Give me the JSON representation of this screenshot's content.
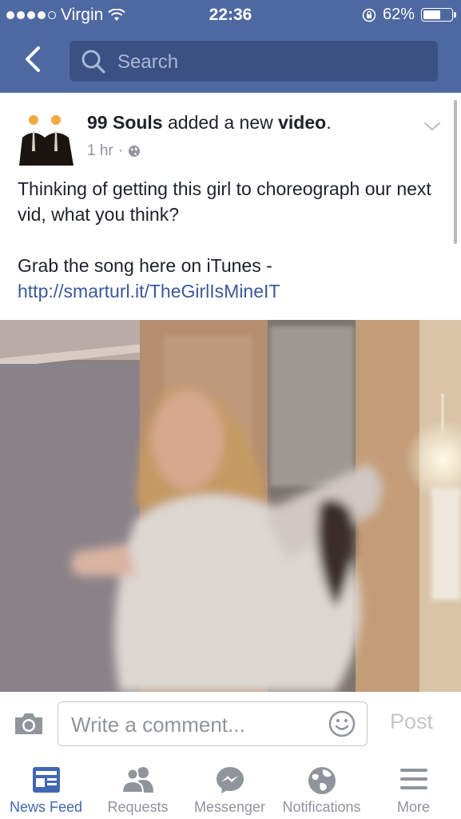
{
  "status": {
    "carrier": "Virgin",
    "time": "22:36",
    "battery_text": "62%",
    "battery_level": 0.62
  },
  "nav": {
    "search_placeholder": "Search"
  },
  "post": {
    "page_name": "99 Souls",
    "action": "added a new",
    "object": "video",
    "punct": ".",
    "time": "1 hr",
    "separator": "·",
    "text_line": "Thinking of getting this girl to choreograph our next vid, what you think?",
    "link_intro": "Grab the song here on iTunes - ",
    "link_url": "http://smarturl.it/TheGirlIsMineIT"
  },
  "comment": {
    "placeholder": "Write a comment...",
    "post_label": "Post"
  },
  "tabs": [
    {
      "label": "News Feed",
      "icon": "news-feed-icon",
      "active": true
    },
    {
      "label": "Requests",
      "icon": "friend-requests-icon",
      "active": false
    },
    {
      "label": "Messenger",
      "icon": "messenger-icon",
      "active": false
    },
    {
      "label": "Notifications",
      "icon": "globe-icon",
      "active": false
    },
    {
      "label": "More",
      "icon": "menu-icon",
      "active": false
    }
  ],
  "colors": {
    "facebook_blue": "#4e69a2",
    "link_blue": "#3b5998",
    "active_tab": "#4267b2"
  }
}
